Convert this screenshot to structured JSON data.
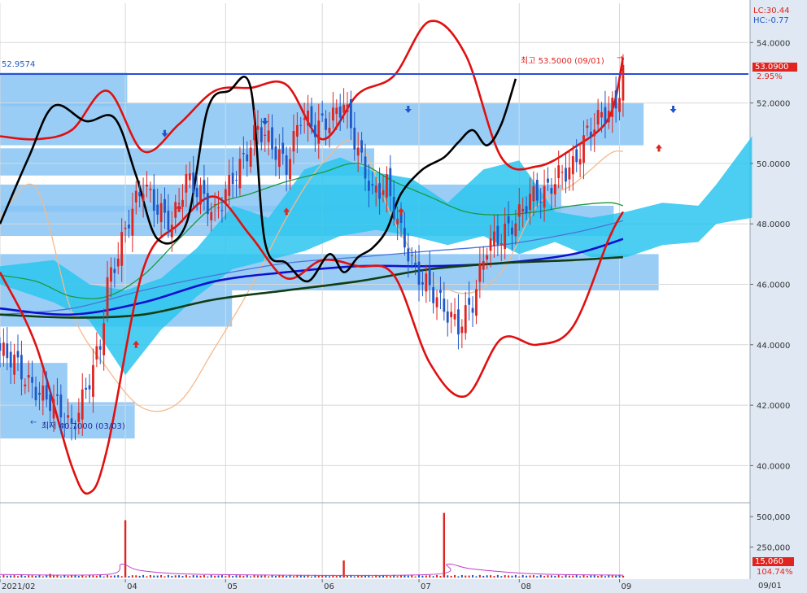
{
  "indicators": {
    "lc": "LC:30.44",
    "hc": "HC:-0.77"
  },
  "price_panel": {
    "left_level_label": "52.9574",
    "current_price_tag": "53.0900",
    "current_change_tag": "2.95%",
    "high_annotation": "최고 53.5000 (09/01)",
    "low_annotation": "최저 40.7000 (03/03)",
    "horizontal_line_value": 52.9574
  },
  "volume_panel": {
    "current_volume_tag": "15,060",
    "volume_ratio_tag": "104.74%"
  },
  "date_tag": "09/01",
  "colors": {
    "up_candle": "#e0241f",
    "down_candle": "#1f57c8",
    "bollinger": "#e01010",
    "line_black": "#000000",
    "ichimoku_cloud": "#2cc5ee",
    "volume_profile": "#87c4f5",
    "ma_short": "#f5b98a",
    "ma_mid": "#1a9a3c",
    "ma_long": "#1010d0",
    "ma_longest": "#123d12",
    "ma_blue_thin": "#4a74d8",
    "level_line": "#2a4fd6",
    "axis_bg": "#dfe8f3"
  },
  "chart_data": {
    "type": "candlestick",
    "y_axis": {
      "range": [
        38.8,
        55.3
      ],
      "ticks": [
        "54.0000",
        "52.0000",
        "50.0000",
        "48.0000",
        "46.0000",
        "44.0000",
        "42.0000",
        "40.0000"
      ],
      "tick_values": [
        54,
        52,
        50,
        48,
        46,
        44,
        42,
        40
      ]
    },
    "volume_axis": {
      "range": [
        0,
        600000
      ],
      "ticks": [
        "500,000",
        "250,000"
      ],
      "tick_values": [
        500000,
        250000
      ]
    },
    "x_axis": {
      "labels": [
        "2021/02",
        "04",
        "05",
        "06",
        "07",
        "08",
        "09"
      ],
      "label_index": [
        0,
        35,
        63,
        90,
        117,
        145,
        173
      ]
    },
    "period_count": 210,
    "last_index": 174,
    "candles_close": [
      [
        0,
        43.8
      ],
      [
        4,
        43.5
      ],
      [
        8,
        42.7
      ],
      [
        12,
        42.3
      ],
      [
        16,
        42.0
      ],
      [
        20,
        41.2
      ],
      [
        24,
        42.5
      ],
      [
        28,
        44.0
      ],
      [
        30,
        46.0
      ],
      [
        33,
        47.0
      ],
      [
        36,
        48.2
      ],
      [
        40,
        49.3
      ],
      [
        44,
        48.5
      ],
      [
        48,
        48.0
      ],
      [
        52,
        49.5
      ],
      [
        56,
        49.0
      ],
      [
        60,
        48.3
      ],
      [
        64,
        49.3
      ],
      [
        68,
        50.1
      ],
      [
        72,
        51.2
      ],
      [
        76,
        50.6
      ],
      [
        80,
        49.9
      ],
      [
        84,
        51.6
      ],
      [
        88,
        51.2
      ],
      [
        92,
        51.4
      ],
      [
        96,
        52.0
      ],
      [
        100,
        50.4
      ],
      [
        104,
        49.0
      ],
      [
        108,
        49.3
      ],
      [
        112,
        47.7
      ],
      [
        116,
        46.4
      ],
      [
        120,
        45.9
      ],
      [
        124,
        45.2
      ],
      [
        128,
        44.6
      ],
      [
        132,
        45.4
      ],
      [
        136,
        47.3
      ],
      [
        140,
        47.6
      ],
      [
        144,
        48.1
      ],
      [
        148,
        48.9
      ],
      [
        152,
        49.0
      ],
      [
        156,
        49.6
      ],
      [
        160,
        49.9
      ],
      [
        164,
        51.0
      ],
      [
        168,
        51.6
      ],
      [
        172,
        51.9
      ],
      [
        174,
        53.09
      ]
    ],
    "series": [
      {
        "values": [
          [
            0,
            48.2
          ],
          [
            10,
            49.2
          ],
          [
            20,
            45.1
          ],
          [
            30,
            43.2
          ],
          [
            40,
            41.9
          ],
          [
            50,
            42.1
          ],
          [
            60,
            43.9
          ],
          [
            70,
            45.9
          ],
          [
            80,
            48.2
          ],
          [
            90,
            50.0
          ],
          [
            100,
            50.7
          ],
          [
            110,
            48.1
          ],
          [
            120,
            46.3
          ],
          [
            130,
            45.7
          ],
          [
            140,
            46.4
          ],
          [
            150,
            48.6
          ],
          [
            160,
            49.3
          ],
          [
            170,
            50.3
          ],
          [
            174,
            50.4
          ]
        ]
      },
      {
        "values": [
          [
            0,
            46.3
          ],
          [
            10,
            46.1
          ],
          [
            20,
            45.6
          ],
          [
            30,
            45.6
          ],
          [
            40,
            46.3
          ],
          [
            50,
            47.5
          ],
          [
            60,
            48.6
          ],
          [
            70,
            49.0
          ],
          [
            80,
            49.4
          ],
          [
            90,
            49.7
          ],
          [
            100,
            50.0
          ],
          [
            110,
            49.4
          ],
          [
            120,
            48.9
          ],
          [
            130,
            48.4
          ],
          [
            140,
            48.3
          ],
          [
            150,
            48.4
          ],
          [
            160,
            48.6
          ],
          [
            170,
            48.7
          ],
          [
            174,
            48.6
          ]
        ]
      },
      {
        "values": [
          [
            0,
            45.0
          ],
          [
            20,
            45.2
          ],
          [
            40,
            45.8
          ],
          [
            60,
            46.3
          ],
          [
            80,
            46.7
          ],
          [
            100,
            46.9
          ],
          [
            120,
            47.1
          ],
          [
            140,
            47.3
          ],
          [
            160,
            47.7
          ],
          [
            174,
            48.1
          ]
        ]
      },
      {
        "values": [
          [
            0,
            45.2
          ],
          [
            20,
            45.0
          ],
          [
            40,
            45.4
          ],
          [
            60,
            46.1
          ],
          [
            80,
            46.4
          ],
          [
            100,
            46.6
          ],
          [
            120,
            46.6
          ],
          [
            140,
            46.7
          ],
          [
            160,
            47.0
          ],
          [
            174,
            47.5
          ]
        ]
      },
      {
        "values": [
          [
            0,
            45.0
          ],
          [
            20,
            44.9
          ],
          [
            40,
            45.0
          ],
          [
            60,
            45.5
          ],
          [
            80,
            45.8
          ],
          [
            100,
            46.1
          ],
          [
            120,
            46.5
          ],
          [
            140,
            46.7
          ],
          [
            160,
            46.8
          ],
          [
            174,
            46.9
          ]
        ]
      },
      {
        "values": [
          [
            0,
            46.4
          ],
          [
            10,
            44.0
          ],
          [
            20,
            40.0
          ],
          [
            25,
            39.1
          ],
          [
            30,
            40.6
          ],
          [
            40,
            46.5
          ],
          [
            50,
            48.0
          ],
          [
            60,
            48.9
          ],
          [
            70,
            47.6
          ],
          [
            80,
            46.2
          ],
          [
            90,
            46.8
          ],
          [
            100,
            46.6
          ],
          [
            110,
            46.3
          ],
          [
            120,
            43.4
          ],
          [
            130,
            42.3
          ],
          [
            140,
            44.2
          ],
          [
            150,
            44.0
          ],
          [
            160,
            44.6
          ],
          [
            170,
            47.5
          ],
          [
            174,
            48.4
          ]
        ]
      },
      {
        "values": [
          [
            0,
            50.9
          ],
          [
            10,
            50.8
          ],
          [
            20,
            51.1
          ],
          [
            30,
            52.4
          ],
          [
            40,
            50.4
          ],
          [
            50,
            51.3
          ],
          [
            60,
            52.4
          ],
          [
            70,
            52.5
          ],
          [
            80,
            52.6
          ],
          [
            90,
            50.8
          ],
          [
            100,
            52.3
          ],
          [
            110,
            52.9
          ],
          [
            120,
            54.7
          ],
          [
            130,
            53.6
          ],
          [
            140,
            50.2
          ],
          [
            150,
            49.9
          ],
          [
            160,
            50.5
          ],
          [
            170,
            51.5
          ],
          [
            174,
            53.5
          ]
        ]
      },
      {
        "values": [
          [
            0,
            48.0
          ],
          [
            8,
            50.2
          ],
          [
            15,
            51.9
          ],
          [
            24,
            51.4
          ],
          [
            32,
            51.5
          ],
          [
            38,
            49.6
          ],
          [
            44,
            47.5
          ],
          [
            52,
            48.0
          ],
          [
            58,
            51.8
          ],
          [
            64,
            52.4
          ],
          [
            70,
            52.5
          ],
          [
            74,
            47.4
          ],
          [
            80,
            46.7
          ],
          [
            86,
            46.1
          ],
          [
            92,
            47.0
          ],
          [
            96,
            46.4
          ],
          [
            100,
            46.9
          ],
          [
            104,
            47.2
          ],
          [
            108,
            47.8
          ],
          [
            112,
            49.0
          ],
          [
            118,
            49.8
          ],
          [
            124,
            50.2
          ],
          [
            128,
            50.7
          ],
          [
            132,
            51.1
          ],
          [
            136,
            50.6
          ],
          [
            140,
            51.3
          ],
          [
            144,
            52.8
          ]
        ]
      }
    ],
    "ichimoku_cloud": [
      [
        0,
        46.6,
        46.0
      ],
      [
        15,
        46.8,
        45.4
      ],
      [
        25,
        46.0,
        44.8
      ],
      [
        35,
        45.8,
        43.0
      ],
      [
        45,
        46.2,
        44.5
      ],
      [
        55,
        47.2,
        45.6
      ],
      [
        65,
        48.6,
        46.5
      ],
      [
        75,
        48.2,
        46.8
      ],
      [
        85,
        49.8,
        47.1
      ],
      [
        95,
        50.2,
        47.6
      ],
      [
        105,
        49.7,
        47.8
      ],
      [
        115,
        49.5,
        47.6
      ],
      [
        125,
        48.7,
        47.3
      ],
      [
        135,
        49.8,
        47.6
      ],
      [
        145,
        50.1,
        47.0
      ],
      [
        155,
        48.4,
        47.4
      ],
      [
        165,
        48.2,
        46.9
      ],
      [
        175,
        48.4,
        46.9
      ],
      [
        185,
        48.7,
        47.3
      ],
      [
        195,
        48.6,
        47.4
      ],
      [
        200,
        49.3,
        48.0
      ],
      [
        210,
        50.9,
        48.2
      ]
    ],
    "volume_profile": [
      [
        53.0,
        51.9,
        0.17
      ],
      [
        52.0,
        50.6,
        0.86
      ],
      [
        50.5,
        49.6,
        0.5
      ],
      [
        49.3,
        48.4,
        0.75
      ],
      [
        48.6,
        47.6,
        0.82
      ],
      [
        47.0,
        45.8,
        0.88
      ],
      [
        45.8,
        44.6,
        0.31
      ],
      [
        43.4,
        42.1,
        0.09
      ],
      [
        42.1,
        40.9,
        0.18
      ]
    ],
    "volume": {
      "baseline": 15000,
      "spikes": [
        [
          14,
          30000
        ],
        [
          35,
          470000
        ],
        [
          96,
          140000
        ],
        [
          124,
          530000
        ],
        [
          174,
          15060
        ]
      ]
    },
    "volume_ma": [
      [
        0,
        25000
      ],
      [
        30,
        26000
      ],
      [
        34,
        110000
      ],
      [
        40,
        55000
      ],
      [
        60,
        25000
      ],
      [
        120,
        25000
      ],
      [
        125,
        110000
      ],
      [
        132,
        70000
      ],
      [
        150,
        30000
      ],
      [
        174,
        20000
      ]
    ],
    "up_signals": [
      [
        38,
        44.0
      ],
      [
        50,
        48.5
      ],
      [
        80,
        48.4
      ],
      [
        112,
        48.4
      ],
      [
        184,
        50.5
      ]
    ],
    "down_signals": [
      [
        46,
        51.0
      ],
      [
        74,
        51.4
      ],
      [
        114,
        51.8
      ],
      [
        188,
        51.8
      ]
    ]
  }
}
